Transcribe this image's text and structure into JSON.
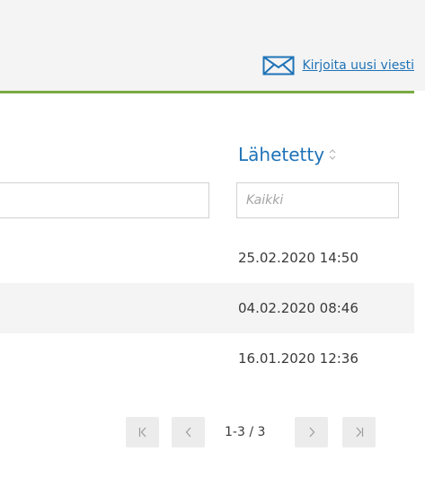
{
  "header": {
    "new_message_label": "Kirjoita uusi viesti",
    "accent_color": "#7aab43",
    "link_color": "#1f73b7"
  },
  "table": {
    "sent_column_title": "Lähetetty",
    "sent_filter_placeholder": "Kaikki",
    "rows": [
      {
        "sent": "25.02.2020 14:50"
      },
      {
        "sent": "04.02.2020 08:46"
      },
      {
        "sent": "16.01.2020 12:36"
      }
    ]
  },
  "pagination": {
    "info": "1-3 / 3"
  },
  "icons": {
    "new_message": "envelope-icon",
    "sort": "sort-arrows-icon",
    "first": "first-page-icon",
    "prev": "chevron-left-icon",
    "next": "chevron-right-icon",
    "last": "last-page-icon"
  }
}
